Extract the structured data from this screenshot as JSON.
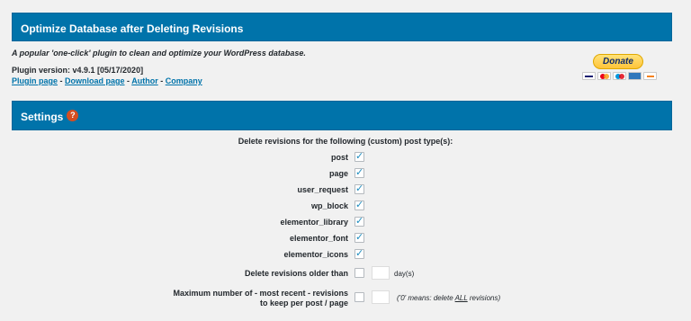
{
  "header": {
    "title": "Optimize Database after Deleting Revisions"
  },
  "intro": {
    "tagline": "A popular 'one-click' plugin to clean and optimize your WordPress database.",
    "version": "Plugin version: v4.9.1 [05/17/2020]",
    "links": [
      "Plugin page",
      "Download page",
      "Author",
      "Company"
    ],
    "separator": " - "
  },
  "donate": {
    "label": "Donate",
    "cards": [
      "visa-icon",
      "mastercard-icon",
      "maestro-icon",
      "amex-icon",
      "discover-icon"
    ]
  },
  "settings": {
    "title": "Settings",
    "help_glyph": "?",
    "post_types_heading": "Delete revisions for the following (custom) post type(s):",
    "post_types": [
      {
        "label": "post",
        "checked": true
      },
      {
        "label": "page",
        "checked": true
      },
      {
        "label": "user_request",
        "checked": true
      },
      {
        "label": "wp_block",
        "checked": true
      },
      {
        "label": "elementor_library",
        "checked": true
      },
      {
        "label": "elementor_font",
        "checked": true
      },
      {
        "label": "elementor_icons",
        "checked": true
      }
    ],
    "older_than": {
      "label": "Delete revisions older than",
      "checked": false,
      "value": "",
      "unit": "day(s)"
    },
    "max_revisions": {
      "label_line1": "Maximum number of - most recent - revisions",
      "label_line2": "to keep per post / page",
      "checked": false,
      "value": "",
      "note_prefix": "('0' means: delete ",
      "note_em": "ALL",
      "note_suffix": " revisions)"
    }
  },
  "colors": {
    "bar": "#0073aa",
    "link": "#0073aa",
    "check": "#1e8cbe",
    "help": "#d54e21"
  }
}
